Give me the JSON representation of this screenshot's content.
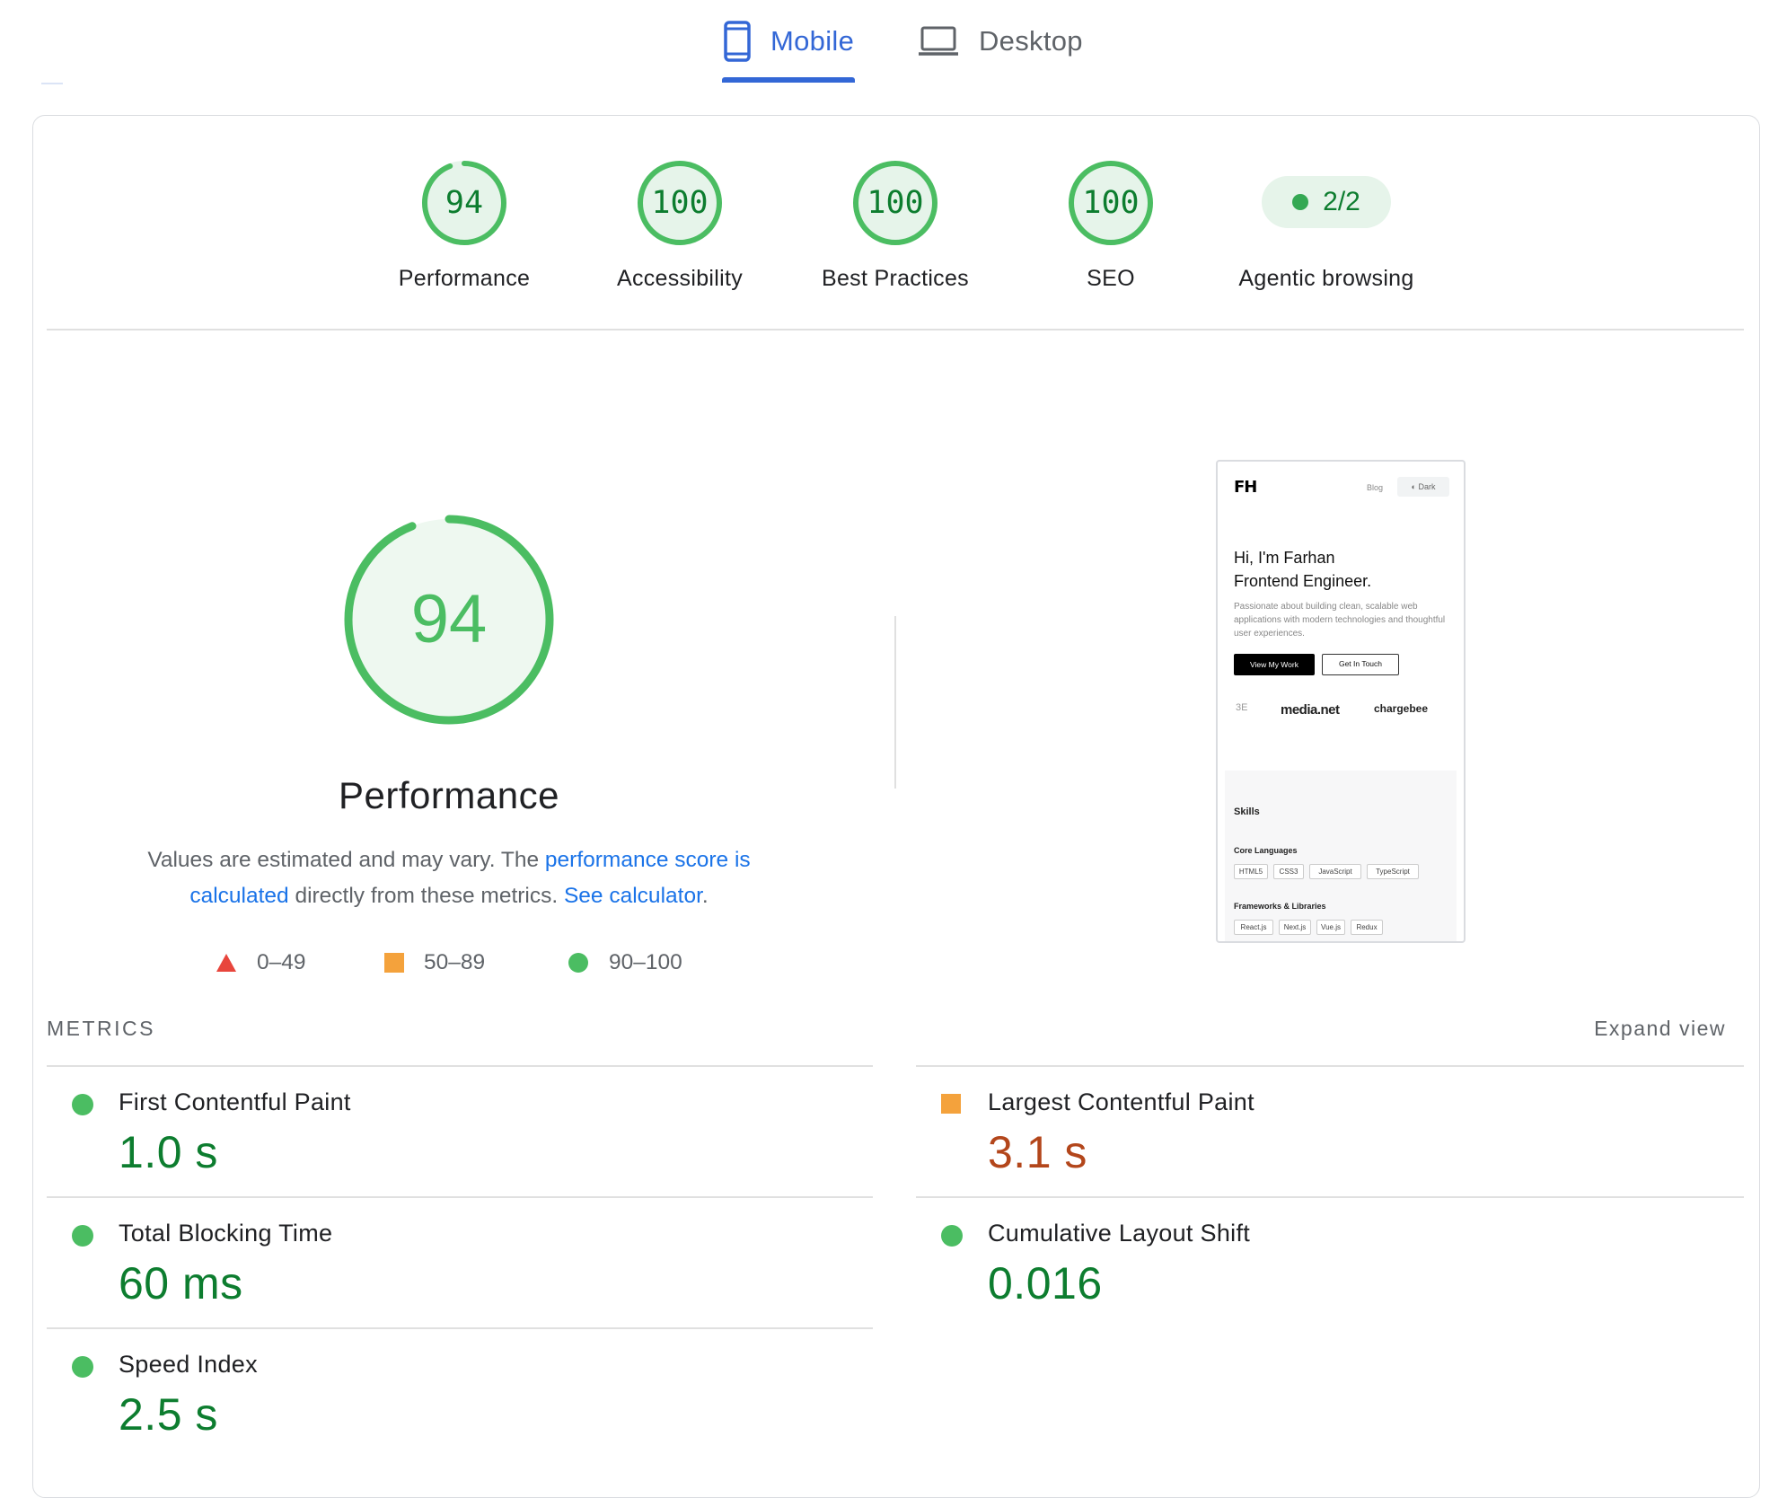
{
  "tabs": {
    "mobile_label": "Mobile",
    "desktop_label": "Desktop",
    "active": "mobile"
  },
  "colors": {
    "accent": "#3367d6",
    "pass": "#4bbd62",
    "pass_text": "#0d7d2f",
    "average": "#f4a23c",
    "average_text": "#b3461b",
    "fail": "#e8453c"
  },
  "gauges": [
    {
      "score": "94",
      "label": "Performance",
      "fraction": 0.94
    },
    {
      "score": "100",
      "label": "Accessibility",
      "fraction": 1.0
    },
    {
      "score": "100",
      "label": "Best Practices",
      "fraction": 1.0
    },
    {
      "score": "100",
      "label": "SEO",
      "fraction": 1.0
    }
  ],
  "agentic": {
    "value": "2/2",
    "label": "Agentic browsing"
  },
  "performance": {
    "score": "94",
    "fraction": 0.94,
    "title": "Performance",
    "desc_pre": "Values are estimated and may vary. The ",
    "desc_link1": "performance score is calculated",
    "desc_mid": " directly from these metrics. ",
    "desc_link2": "See calculator",
    "desc_post": "."
  },
  "legend": {
    "fail": "0–49",
    "average": "50–89",
    "pass": "90–100"
  },
  "thumbnail": {
    "logo": "FH",
    "nav_blog": "Blog",
    "nav_dark": "◐ Dark",
    "hi_line1": "Hi, I'm Farhan",
    "hi_line2": "Frontend Engineer.",
    "para": "Passionate about building clean, scalable web applications with modern technologies and thoughtful user experiences.",
    "btn_work": "View My Work",
    "btn_touch": "Get In Touch",
    "logo_a": "3E",
    "logo_b": "media.net",
    "logo_c": "chargebee",
    "skills": "Skills",
    "core_heading": "Core Languages",
    "core_tags": [
      "HTML5",
      "CSS3",
      "JavaScript",
      "TypeScript"
    ],
    "fw_heading": "Frameworks & Libraries",
    "fw_tags": [
      "React.js",
      "Next.js",
      "Vue.js",
      "Redux"
    ]
  },
  "metrics": {
    "heading": "METRICS",
    "expand": "Expand view",
    "items": [
      {
        "label": "First Contentful Paint",
        "value": "1.0 s",
        "rating": "pass"
      },
      {
        "label": "Largest Contentful Paint",
        "value": "3.1 s",
        "rating": "average"
      },
      {
        "label": "Total Blocking Time",
        "value": "60 ms",
        "rating": "pass"
      },
      {
        "label": "Cumulative Layout Shift",
        "value": "0.016",
        "rating": "pass"
      },
      {
        "label": "Speed Index",
        "value": "2.5 s",
        "rating": "pass"
      }
    ]
  }
}
